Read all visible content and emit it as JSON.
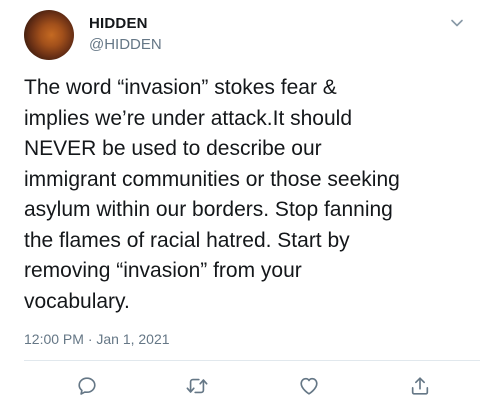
{
  "tweet": {
    "display_name": "HIDDEN",
    "handle": "@HIDDEN",
    "lines": [
      "The word “invasion” stokes fear &",
      "implies we’re under attack.It should",
      "NEVER be used to describe our",
      "immigrant communities or those seeking",
      "asylum within our borders. Stop fanning",
      "the flames of racial hatred. Start by",
      "removing “invasion” from your",
      "vocabulary."
    ],
    "timestamp": "12:00 PM · Jan 1, 2021"
  },
  "icons": {
    "menu": "chevron-down-icon",
    "reply": "reply-icon",
    "retweet": "retweet-icon",
    "like": "heart-icon",
    "share": "share-icon"
  },
  "colors": {
    "text": "#14171a",
    "secondary": "#657786",
    "icon": "#657786",
    "divider": "#e1e8ed"
  }
}
